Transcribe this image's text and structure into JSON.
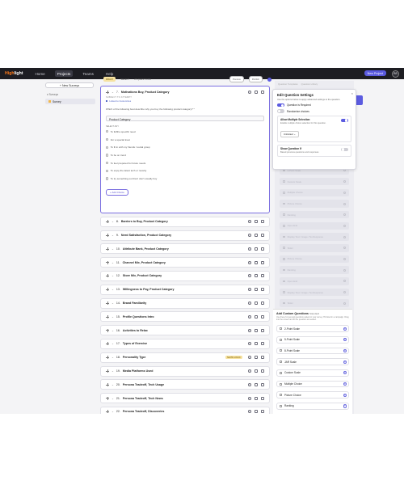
{
  "nav": {
    "logo_hi": "High",
    "logo_rest": "light",
    "links": [
      "Home",
      "Projects",
      "Teams",
      "Help"
    ],
    "active": "Projects",
    "new_project": "New Project",
    "avatar": "BS"
  },
  "sidebar": {
    "new_survey": "+ New Surveys",
    "section": "Surveys",
    "item": "Survey"
  },
  "topbar": {
    "pill": "DRAFT",
    "count": "SELECT",
    "questions": "25 QUESTIONS",
    "preview": "Preview",
    "publish": "Publish"
  },
  "open_question": {
    "number": "7.",
    "title": "Motivations Buy, Product Category",
    "subject_label": "SUBJECT TO ATTEMPT",
    "link": "Linked to Customizes",
    "prompt": "Which of the following best describe why you buy the following product category? *",
    "answer": "Product Category",
    "select_label": "SELECT ANY",
    "choices": [
      "To fulfill a specific need",
      "For a special treat",
      "To fit in with my friends / social group",
      "To be on trend",
      "To feel prepared for future needs",
      "To enjoy the latest tech or novelty",
      "To try something out that I don't usually buy"
    ],
    "add_choice": "+ Add Choice"
  },
  "questions": [
    {
      "num": "8.",
      "title": "Barriers to Buy, Product Category",
      "badge": ""
    },
    {
      "num": "9.",
      "title": "Need Satisfaction, Product Category",
      "badge": ""
    },
    {
      "num": "10.",
      "title": "Attribute Bank, Product Category",
      "badge": ""
    },
    {
      "num": "11.",
      "title": "Channel Mix, Product Category",
      "badge": ""
    },
    {
      "num": "12.",
      "title": "Store Mix, Product Category",
      "badge": ""
    },
    {
      "num": "13.",
      "title": "Willingness to Pay, Product Category",
      "badge": ""
    },
    {
      "num": "14.",
      "title": "Brand Familiarity",
      "badge": ""
    },
    {
      "num": "15.",
      "title": "Profile Questions Intro",
      "badge": ""
    },
    {
      "num": "16.",
      "title": "Activities to Relax",
      "badge": ""
    },
    {
      "num": "17.",
      "title": "Types of Exercise",
      "badge": ""
    },
    {
      "num": "18.",
      "title": "Personality Type",
      "badge": "SHOW LOGIC"
    },
    {
      "num": "19.",
      "title": "Media Platforms Used",
      "badge": ""
    },
    {
      "num": "20.",
      "title": "Persona Tradeoff, Tech Usage",
      "badge": ""
    },
    {
      "num": "21.",
      "title": "Persona Tradeoff, Tech News",
      "badge": ""
    },
    {
      "num": "22.",
      "title": "Persona Tradeoff, Discoveries",
      "badge": ""
    }
  ],
  "right_panel": {
    "tabs": [
      "Question Templates",
      "Question Library"
    ],
    "ghost_rows": [
      "2-Point Scale",
      "Custom Scale",
      "Multiple Choice",
      "Picture Choice",
      "Ranking",
      "Open End",
      "Display Text / Image / No Response",
      "Slider",
      "Picture Choice",
      "Ranking",
      "Open End",
      "Display Text / Image / No Response",
      "Slider"
    ]
  },
  "settings": {
    "title": "Edit Question Settings",
    "desc": "Use the options below to apply advanced settings to the question.",
    "required": "Question is Required",
    "randomize": "Randomize choices",
    "multi_title": "Allow Multiple Selection",
    "multi_sub": "Enable multiple choice selection for this question.",
    "multi_value": "Unlimited",
    "show_if_title": "Show Question If",
    "show_if_sub": "Based previous questions and responses"
  },
  "custom": {
    "title": "Add Custom Questions",
    "title_sub": "Standard",
    "desc": "Use these for general questions asked on your survey. Hit listed in a campaign. Drag into the screen and fill the question as needed.",
    "rows": [
      "2-Point Scale",
      "5-Point Scale",
      "8-Point Scale",
      "JAR Scale",
      "Custom Scale",
      "Multiple Choice",
      "Picture Choice",
      "Ranking"
    ]
  },
  "colors": {
    "accent": "#5b5be0",
    "nav_bg": "#1d1d22",
    "logo_accent": "#ff7a1a",
    "badge": "#f6e2a0"
  }
}
